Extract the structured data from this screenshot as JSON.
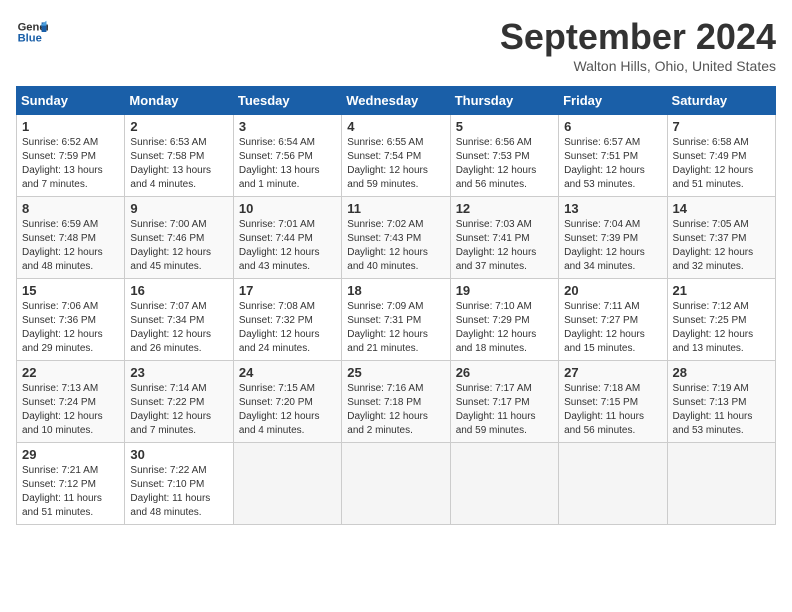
{
  "logo": {
    "line1": "General",
    "line2": "Blue"
  },
  "title": "September 2024",
  "location": "Walton Hills, Ohio, United States",
  "days_of_week": [
    "Sunday",
    "Monday",
    "Tuesday",
    "Wednesday",
    "Thursday",
    "Friday",
    "Saturday"
  ],
  "weeks": [
    [
      {
        "day": "1",
        "sunrise": "6:52 AM",
        "sunset": "7:59 PM",
        "daylight": "13 hours and 7 minutes."
      },
      {
        "day": "2",
        "sunrise": "6:53 AM",
        "sunset": "7:58 PM",
        "daylight": "13 hours and 4 minutes."
      },
      {
        "day": "3",
        "sunrise": "6:54 AM",
        "sunset": "7:56 PM",
        "daylight": "13 hours and 1 minute."
      },
      {
        "day": "4",
        "sunrise": "6:55 AM",
        "sunset": "7:54 PM",
        "daylight": "12 hours and 59 minutes."
      },
      {
        "day": "5",
        "sunrise": "6:56 AM",
        "sunset": "7:53 PM",
        "daylight": "12 hours and 56 minutes."
      },
      {
        "day": "6",
        "sunrise": "6:57 AM",
        "sunset": "7:51 PM",
        "daylight": "12 hours and 53 minutes."
      },
      {
        "day": "7",
        "sunrise": "6:58 AM",
        "sunset": "7:49 PM",
        "daylight": "12 hours and 51 minutes."
      }
    ],
    [
      {
        "day": "8",
        "sunrise": "6:59 AM",
        "sunset": "7:48 PM",
        "daylight": "12 hours and 48 minutes."
      },
      {
        "day": "9",
        "sunrise": "7:00 AM",
        "sunset": "7:46 PM",
        "daylight": "12 hours and 45 minutes."
      },
      {
        "day": "10",
        "sunrise": "7:01 AM",
        "sunset": "7:44 PM",
        "daylight": "12 hours and 43 minutes."
      },
      {
        "day": "11",
        "sunrise": "7:02 AM",
        "sunset": "7:43 PM",
        "daylight": "12 hours and 40 minutes."
      },
      {
        "day": "12",
        "sunrise": "7:03 AM",
        "sunset": "7:41 PM",
        "daylight": "12 hours and 37 minutes."
      },
      {
        "day": "13",
        "sunrise": "7:04 AM",
        "sunset": "7:39 PM",
        "daylight": "12 hours and 34 minutes."
      },
      {
        "day": "14",
        "sunrise": "7:05 AM",
        "sunset": "7:37 PM",
        "daylight": "12 hours and 32 minutes."
      }
    ],
    [
      {
        "day": "15",
        "sunrise": "7:06 AM",
        "sunset": "7:36 PM",
        "daylight": "12 hours and 29 minutes."
      },
      {
        "day": "16",
        "sunrise": "7:07 AM",
        "sunset": "7:34 PM",
        "daylight": "12 hours and 26 minutes."
      },
      {
        "day": "17",
        "sunrise": "7:08 AM",
        "sunset": "7:32 PM",
        "daylight": "12 hours and 24 minutes."
      },
      {
        "day": "18",
        "sunrise": "7:09 AM",
        "sunset": "7:31 PM",
        "daylight": "12 hours and 21 minutes."
      },
      {
        "day": "19",
        "sunrise": "7:10 AM",
        "sunset": "7:29 PM",
        "daylight": "12 hours and 18 minutes."
      },
      {
        "day": "20",
        "sunrise": "7:11 AM",
        "sunset": "7:27 PM",
        "daylight": "12 hours and 15 minutes."
      },
      {
        "day": "21",
        "sunrise": "7:12 AM",
        "sunset": "7:25 PM",
        "daylight": "12 hours and 13 minutes."
      }
    ],
    [
      {
        "day": "22",
        "sunrise": "7:13 AM",
        "sunset": "7:24 PM",
        "daylight": "12 hours and 10 minutes."
      },
      {
        "day": "23",
        "sunrise": "7:14 AM",
        "sunset": "7:22 PM",
        "daylight": "12 hours and 7 minutes."
      },
      {
        "day": "24",
        "sunrise": "7:15 AM",
        "sunset": "7:20 PM",
        "daylight": "12 hours and 4 minutes."
      },
      {
        "day": "25",
        "sunrise": "7:16 AM",
        "sunset": "7:18 PM",
        "daylight": "12 hours and 2 minutes."
      },
      {
        "day": "26",
        "sunrise": "7:17 AM",
        "sunset": "7:17 PM",
        "daylight": "11 hours and 59 minutes."
      },
      {
        "day": "27",
        "sunrise": "7:18 AM",
        "sunset": "7:15 PM",
        "daylight": "11 hours and 56 minutes."
      },
      {
        "day": "28",
        "sunrise": "7:19 AM",
        "sunset": "7:13 PM",
        "daylight": "11 hours and 53 minutes."
      }
    ],
    [
      {
        "day": "29",
        "sunrise": "7:21 AM",
        "sunset": "7:12 PM",
        "daylight": "11 hours and 51 minutes."
      },
      {
        "day": "30",
        "sunrise": "7:22 AM",
        "sunset": "7:10 PM",
        "daylight": "11 hours and 48 minutes."
      },
      null,
      null,
      null,
      null,
      null
    ]
  ]
}
